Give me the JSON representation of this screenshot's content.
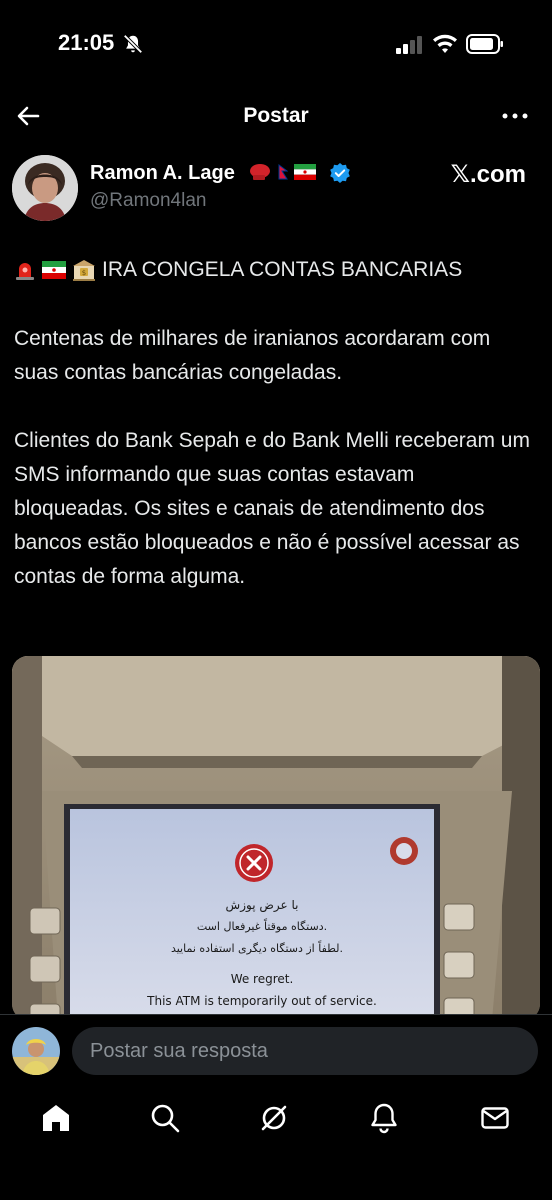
{
  "status_bar": {
    "time": "21:05"
  },
  "header": {
    "title": "Postar"
  },
  "author": {
    "name": "Ramon A. Lage",
    "handle": "@Ramon4lan",
    "brand": "𝕏.com"
  },
  "post": {
    "headline": "IRA CONGELA CONTAS BANCARIAS",
    "paragraphs": [
      "Centenas de milhares de iranianos acordaram com suas contas bancárias congeladas.",
      "Clientes do Bank Sepah e do Bank Melli receberam um SMS informando que suas contas estavam bloqueadas. Os sites e canais de atendimento dos bancos estão bloqueados e não é possível acessar as contas de forma alguma."
    ],
    "media": {
      "line1_fa": "با عرض پوزش",
      "line2_fa": "دستگاه موقتاً غیرفعال است.",
      "line3_fa": "لطفاً از دستگاه دیگری استفاده نمایید.",
      "line4_en": "We regret.",
      "line5_en": "This ATM is temporarily out of service."
    }
  },
  "reply": {
    "placeholder": "Postar sua resposta"
  },
  "icons": {
    "back": "arrow-left-icon",
    "more": "more-icon",
    "verified": "verified-badge-icon",
    "nav": [
      "home-icon",
      "search-icon",
      "grok-icon",
      "notifications-icon",
      "messages-icon"
    ]
  },
  "colors": {
    "background": "#000000",
    "text": "#e7e9ea",
    "muted": "#71767b",
    "verified": "#1d9bf0"
  }
}
